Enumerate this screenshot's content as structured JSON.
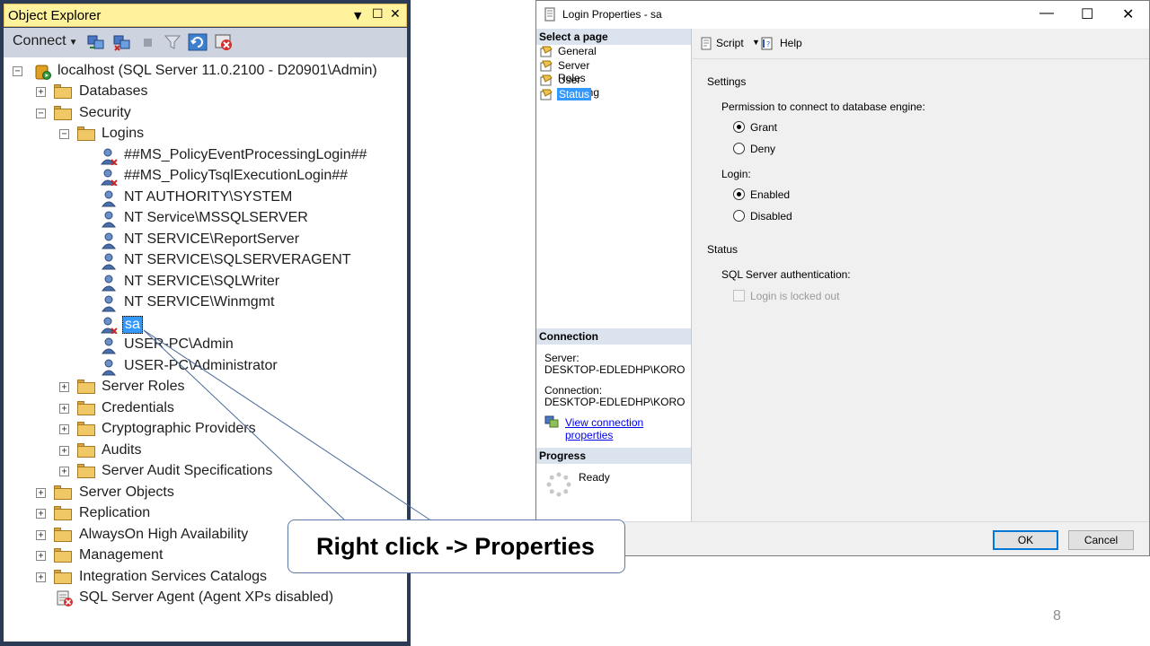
{
  "object_explorer": {
    "title": "Object Explorer",
    "title_controls": {
      "dropdown": "▼",
      "maximize": "☐",
      "close": "✕"
    },
    "connect_label": "Connect",
    "toolbar_icons": [
      "connect-object-explorer-icon",
      "disconnect-icon",
      "stop-icon",
      "filter-icon",
      "refresh-icon",
      "start-powershell-icon"
    ],
    "tree": {
      "root": "localhost (SQL Server 11.0.2100 - D20901\\Admin)",
      "databases": "Databases",
      "security": "Security",
      "logins": "Logins",
      "login_items": [
        "##MS_PolicyEventProcessingLogin##",
        "##MS_PolicyTsqlExecutionLogin##",
        "NT AUTHORITY\\SYSTEM",
        "NT Service\\MSSQLSERVER",
        "NT SERVICE\\ReportServer",
        "NT SERVICE\\SQLSERVERAGENT",
        "NT SERVICE\\SQLWriter",
        "NT SERVICE\\Winmgmt",
        "sa",
        "USER-PC\\Admin",
        "USER-PC\\Administrator"
      ],
      "security_children": [
        "Server Roles",
        "Credentials",
        "Cryptographic Providers",
        "Audits",
        "Server Audit Specifications"
      ],
      "server_children": [
        "Server Objects",
        "Replication",
        "AlwaysOn High Availability",
        "Management",
        "Integration Services Catalogs"
      ],
      "agent": "SQL Server Agent (Agent XPs disabled)"
    }
  },
  "dialog": {
    "title": "Login Properties - sa",
    "select_page_header": "Select a page",
    "pages": [
      "General",
      "Server Roles",
      "User Mapping",
      "Status"
    ],
    "selected_page": "Status",
    "connection_header": "Connection",
    "server_label": "Server:",
    "server_value": "DESKTOP-EDLEDHP\\KORO",
    "connection_label": "Connection:",
    "connection_value": "DESKTOP-EDLEDHP\\KORO",
    "view_connection_properties": "View connection properties",
    "progress_header": "Progress",
    "progress_status": "Ready",
    "toolbar": {
      "script": "Script",
      "help": "Help"
    },
    "settings_title": "Settings",
    "permission_label": "Permission to connect to database engine:",
    "grant": "Grant",
    "deny": "Deny",
    "permission_selected": "Grant",
    "login_label": "Login:",
    "enabled": "Enabled",
    "disabled": "Disabled",
    "login_selected": "Enabled",
    "status_title": "Status",
    "sql_auth_label": "SQL Server authentication:",
    "locked_out": "Login is locked out",
    "locked_out_checked": false,
    "ok": "OK",
    "cancel": "Cancel"
  },
  "callout": "Right click -> Properties",
  "slide_number": "8"
}
